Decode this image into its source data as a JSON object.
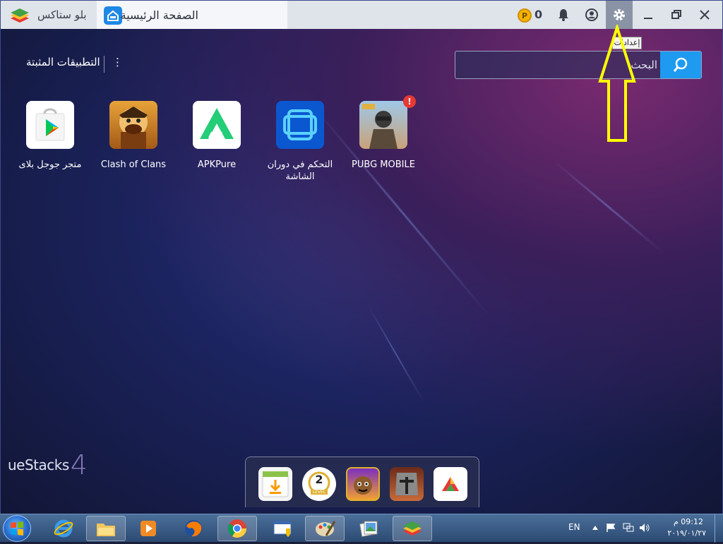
{
  "window": {
    "app_name": "بلو ستاكس",
    "home_tab_label": "الصفحة الرئيسية",
    "coins": "0",
    "coin_symbol": "P"
  },
  "controls": {
    "settings_tooltip": "إعدادات"
  },
  "installed": {
    "title": "التطبيقات المثبتة",
    "menu_glyph": "⋮"
  },
  "search": {
    "placeholder": "البحث"
  },
  "apps": [
    {
      "label": "متجر جوجل بلاى",
      "icon": "google-play-icon"
    },
    {
      "label": "Clash of Clans",
      "icon": "clash-of-clans-icon"
    },
    {
      "label": "APKPure",
      "icon": "apkpure-icon"
    },
    {
      "label": "التحكم في دوران الشاشة",
      "icon": "rotation-control-icon"
    },
    {
      "label": "PUBG MOBILE",
      "icon": "pubg-icon",
      "badge": "!"
    }
  ],
  "brand_text": "ueStacks",
  "brand_version": "4",
  "dock": [
    {
      "icon": "app-installer-icon"
    },
    {
      "icon": "level-badge-icon",
      "level": "2",
      "level_word": "LEVEL"
    },
    {
      "icon": "game-character-icon"
    },
    {
      "icon": "knight-game-icon"
    },
    {
      "icon": "app-center-icon"
    }
  ],
  "taskbar": {
    "lang": "EN",
    "time": "09:12 م",
    "date": "٢٠١٩/٠١/٢٧"
  },
  "colors": {
    "accent_blue": "#1e9af0",
    "arrow_yellow": "#ffff00",
    "badge_red": "#e53935"
  }
}
